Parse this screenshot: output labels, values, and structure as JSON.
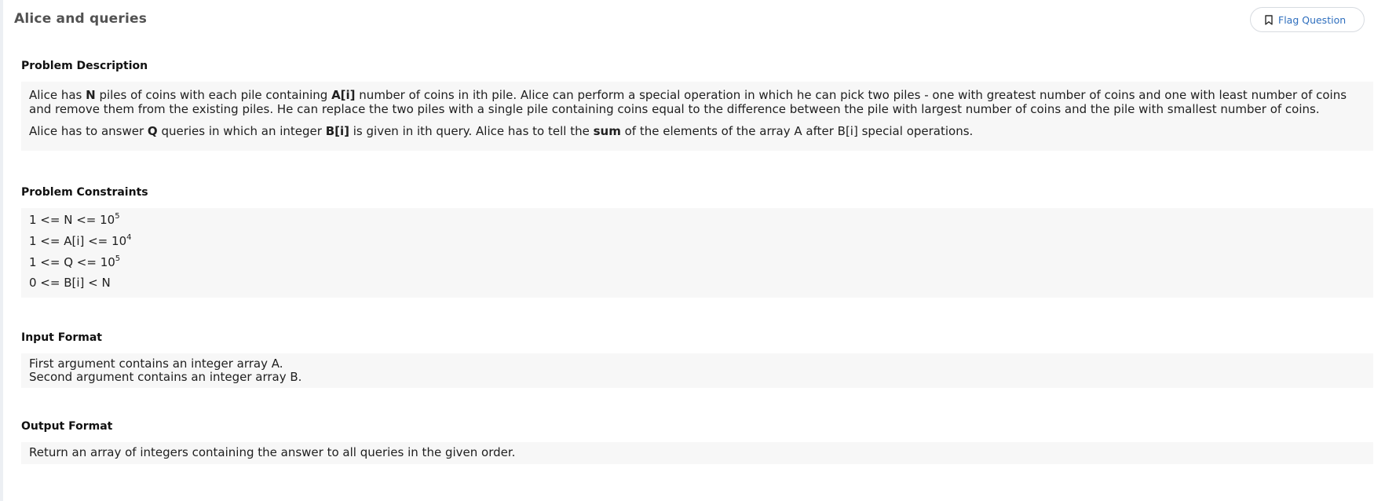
{
  "header": {
    "title": "Alice and queries",
    "flag_label": "Flag Question"
  },
  "description": {
    "heading": "Problem Description",
    "p1": [
      {
        "text": "Alice has ",
        "bold": false
      },
      {
        "text": "N",
        "bold": true
      },
      {
        "text": " piles of coins with each pile containing ",
        "bold": false
      },
      {
        "text": "A[i]",
        "bold": true
      },
      {
        "text": " number of coins in ith pile. Alice can perform a special operation in which he can pick two piles - one with greatest number of coins and one with least number of coins and remove them from the existing piles. He can replace the two piles with a single pile containing coins equal to the difference between the pile with largest number of coins and the pile with smallest number of coins.",
        "bold": false
      }
    ],
    "p2": [
      {
        "text": "Alice has to answer ",
        "bold": false
      },
      {
        "text": "Q",
        "bold": true
      },
      {
        "text": " queries in which an integer ",
        "bold": false
      },
      {
        "text": "B[i]",
        "bold": true
      },
      {
        "text": " is given in ith query. Alice has to tell the ",
        "bold": false
      },
      {
        "text": "sum",
        "bold": true
      },
      {
        "text": " of the elements of the array A after B[i] special operations.",
        "bold": false
      }
    ]
  },
  "constraints": {
    "heading": "Problem Constraints",
    "lines": [
      {
        "base": "1 <= N <= 10",
        "sup": "5"
      },
      {
        "base": "1 <= A[i] <= 10",
        "sup": "4"
      },
      {
        "base": "1 <= Q <= 10",
        "sup": "5"
      },
      {
        "base": "0 <= B[i] < N",
        "sup": ""
      }
    ]
  },
  "input_format": {
    "heading": "Input Format",
    "line1": "First argument contains an integer array A.",
    "line2": "Second argument contains an integer array B."
  },
  "output_format": {
    "heading": "Output Format",
    "text": "Return an array of integers containing the answer to all queries in the given order."
  }
}
